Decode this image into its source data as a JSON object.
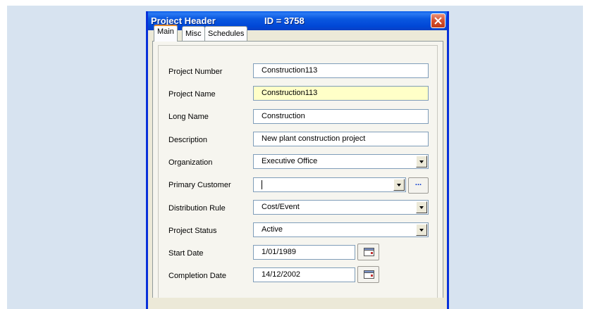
{
  "window": {
    "title": "Project Header",
    "record_id": "ID = 3758"
  },
  "tabs": [
    {
      "label": "Main",
      "active": true
    },
    {
      "label": "Misc",
      "active": false
    },
    {
      "label": "Schedules",
      "active": false
    }
  ],
  "fields": {
    "project_number": {
      "label": "Project Number",
      "value": "Construction113"
    },
    "project_name": {
      "label": "Project Name",
      "value": "Construction113"
    },
    "long_name": {
      "label": "Long Name",
      "value": "Construction"
    },
    "description": {
      "label": "Description",
      "value": "New plant construction project"
    },
    "organization": {
      "label": "Organization",
      "value": "Executive Office"
    },
    "primary_customer": {
      "label": "Primary Customer",
      "value": "",
      "browse_label": "..."
    },
    "distribution_rule": {
      "label": "Distribution Rule",
      "value": "Cost/Event"
    },
    "project_status": {
      "label": "Project Status",
      "value": "Active"
    },
    "start_date": {
      "label": "Start Date",
      "value": "1/01/1989"
    },
    "completion_date": {
      "label": "Completion Date",
      "value": "14/12/2002"
    }
  },
  "colors": {
    "titlebar": "#0a58e0",
    "highlight_field": "#ffffc8",
    "active_tab_accent": "#e68b2c",
    "close_button": "#d5502e"
  }
}
